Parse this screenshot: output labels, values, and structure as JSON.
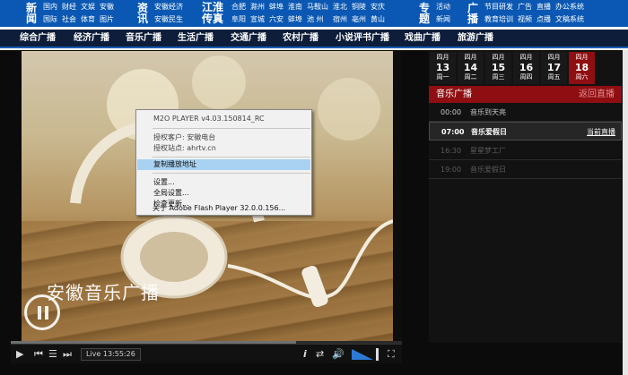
{
  "top": {
    "groups": [
      {
        "head": "新闻",
        "links": [
          "国内",
          "国际",
          "财经",
          "社会",
          "文娱",
          "体育",
          "安徽",
          "图片"
        ]
      },
      {
        "head": "资讯",
        "links": [
          "安徽经济",
          "安徽民生"
        ]
      },
      {
        "head": "江淮传真",
        "links": [
          "合肥",
          "阜阳",
          "滁州",
          "宣城",
          "蚌埠",
          "六安",
          "淮南",
          "蚌埠",
          "马鞍山",
          "池 州",
          "淮北",
          "宿州",
          "铜陵",
          "亳州",
          "安庆",
          "黄山"
        ]
      },
      {
        "head": "专题",
        "links": [
          "活动",
          "新闻"
        ]
      },
      {
        "head": "广播",
        "links": [
          "节目研发",
          "教育培训",
          "广告",
          "视频",
          "直播",
          "点播",
          "办公系统",
          "文稿系统"
        ]
      }
    ]
  },
  "nav": {
    "items": [
      "综合广播",
      "经济广播",
      "音乐广播",
      "生活广播",
      "交通广播",
      "农村广播",
      "小说评书广播",
      "戏曲广播",
      "旅游广播"
    ]
  },
  "player": {
    "watermark": "安徽音乐广播",
    "live_time": "Live  13:55:26",
    "progress": 0.73,
    "volume": 0.8,
    "controls": {
      "play": "▶",
      "prev": "⏮",
      "list": "☰",
      "next": "⏭",
      "info": "i",
      "volume": "🔊",
      "fullscreen": "⛶"
    }
  },
  "context_menu": {
    "items": [
      "M2O PLAYER v4.03.150814_RC",
      "授权客户: 安徽电台",
      "授权站点: ahrtv.cn",
      "复制播放地址",
      "设置...",
      "全局设置...",
      "检查更新...",
      "关于 Adobe Flash Player 32.0.0.156..."
    ]
  },
  "schedule": {
    "days": [
      {
        "month": "四月",
        "day": "13",
        "week": "周一"
      },
      {
        "month": "四月",
        "day": "14",
        "week": "周二"
      },
      {
        "month": "四月",
        "day": "15",
        "week": "周三"
      },
      {
        "month": "四月",
        "day": "16",
        "week": "周四"
      },
      {
        "month": "四月",
        "day": "17",
        "week": "周五"
      },
      {
        "month": "四月",
        "day": "18",
        "week": "周六"
      }
    ],
    "channel": "音乐广播",
    "back_live": "返回直播",
    "programs": [
      {
        "time": "00:00",
        "name": "音乐到天亮",
        "state": ""
      },
      {
        "time": "07:00",
        "name": "音乐爱假日",
        "state": "当前直播"
      },
      {
        "time": "16:30",
        "name": "星星梦工厂",
        "state": ""
      },
      {
        "time": "19:00",
        "name": "音乐爱假日",
        "state": ""
      }
    ]
  },
  "colors": {
    "brand_blue": "#0a58b3",
    "nav_bg": "#0d1d3a",
    "accent_red": "#8f0e12",
    "menu_highlight": "#a9d2f2"
  }
}
